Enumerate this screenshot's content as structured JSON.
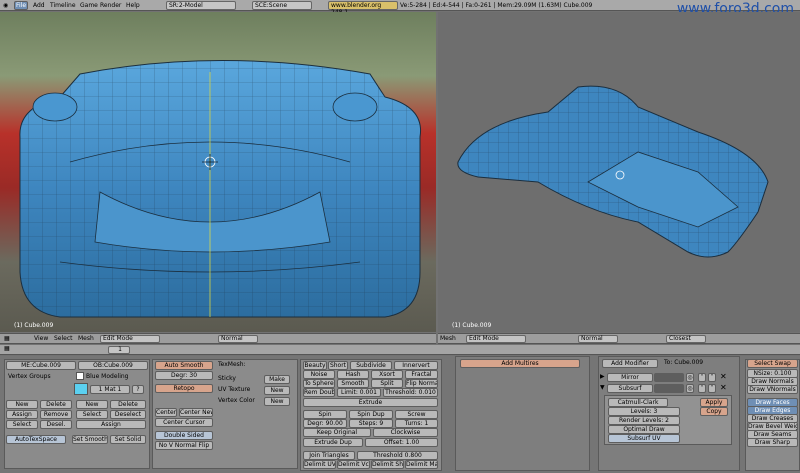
{
  "topbar": {
    "file": "File",
    "add": "Add",
    "timeline": "Timeline",
    "game": "Game",
    "render": "Render",
    "help": "Help",
    "screen": "SR:2-Model",
    "scene": "SCE:Scene",
    "url": "www.blender.org 248.1",
    "stats": "Ve:5-284 | Ed:4-544 | Fa:0-261 | Mem:29.09M (1.63M) Cube.009"
  },
  "watermark": "www.foro3d.com",
  "viewport_left": {
    "label": "(1) Cube.009"
  },
  "viewport_right": {
    "label": "(1) Cube.009"
  },
  "header_left": {
    "view": "View",
    "select": "Select",
    "mesh": "Mesh",
    "mode": "Edit Mode",
    "shading": "Normal"
  },
  "header_right": {
    "mesh": "Mesh",
    "mode": "Edit Mode",
    "shading": "Normal",
    "snap": "Closest"
  },
  "panelbar": {
    "frame": "1"
  },
  "link_panel": {
    "me": "ME:Cube.009",
    "ob": "OB:Cube.009",
    "vertex_groups": "Vertex Groups",
    "material": "Blue Modeling",
    "mat_slot": "1 Mat 1",
    "new1": "New",
    "delete1": "Delete",
    "new2": "New",
    "delete2": "Delete",
    "assign1": "Assign",
    "remove": "Remove",
    "select1": "Select",
    "deselect1": "Deselect",
    "select2": "Select",
    "desel2": "Desel.",
    "assign2": "Assign",
    "autotex": "AutoTexSpace",
    "set_smooth": "Set Smooth",
    "set_solid": "Set Solid"
  },
  "mesh_panel": {
    "auto_smooth": "Auto Smooth",
    "degr": "Degr: 30",
    "retopo": "Retopo",
    "texmesh": "TexMesh:",
    "sticky": "Sticky",
    "make": "Make",
    "uv_texture": "UV Texture",
    "new_uv": "New",
    "vertex_color": "Vertex Color",
    "new_vc": "New",
    "center": "Center",
    "center_new": "Center New",
    "center_cursor": "Center Cursor",
    "double_sided": "Double Sided",
    "no_v_normal_flip": "No V Normal Flip"
  },
  "tools_panel": {
    "beauty": "Beauty",
    "short": "Short",
    "subdivide": "Subdivide",
    "innervert": "Innervert",
    "noise": "Noise",
    "hash": "Hash",
    "xsort": "Xsort",
    "fractal": "Fractal",
    "to_sphere": "To Sphere",
    "smooth": "Smooth",
    "split": "Split",
    "flip_normal": "Flip Normal",
    "rem_doubl": "Rem Doubl",
    "limit": "Limit: 0.001",
    "threshold1": "Threshold: 0.010",
    "extrude": "Extrude",
    "spin": "Spin",
    "spin_dup": "Spin Dup",
    "screw": "Screw",
    "degr90": "Degr: 90.00",
    "steps": "Steps: 9",
    "turns": "Turns: 1",
    "keep_original": "Keep Original",
    "clockwise": "Clockwise",
    "extrude_dup": "Extrude Dup",
    "offset": "Offset: 1.00",
    "join_triangles": "Join Triangles",
    "threshold2": "Threshold 0.800",
    "delimit_uvs": "Delimit UVs",
    "delimit_vcol": "Delimit Vcol",
    "delimit_shar": "Delimit Shar",
    "delimit_mat": "Delimit Mat"
  },
  "multires_panel": {
    "add_multires": "Add Multires"
  },
  "modifiers_panel": {
    "add_modifier": "Add Modifier",
    "to": "To: Cube.009",
    "mirror": "Mirror",
    "subsurf": "Subsurf",
    "catmull": "Catmull-Clark",
    "levels": "Levels: 3",
    "render_levels": "Render Levels: 2",
    "optimal_draw": "Optimal Draw",
    "subsurf_uv": "Subsurf UV",
    "apply": "Apply",
    "copy": "Copy"
  },
  "draw_panel": {
    "select_swap": "Select Swap",
    "nsize": "NSize: 0.100",
    "draw_normals": "Draw Normals",
    "draw_vnormals": "Draw VNormals",
    "draw_faces": "Draw Faces",
    "draw_edges": "Draw Edges",
    "draw_creases": "Draw Creases",
    "draw_bevel": "Draw Bevel Weig",
    "draw_seams": "Draw Seams",
    "draw_sharp": "Draw Sharp"
  },
  "colors": {
    "mesh": "#3e86bf",
    "accent": "#6f8fb5",
    "salmon": "#d7a48c"
  }
}
